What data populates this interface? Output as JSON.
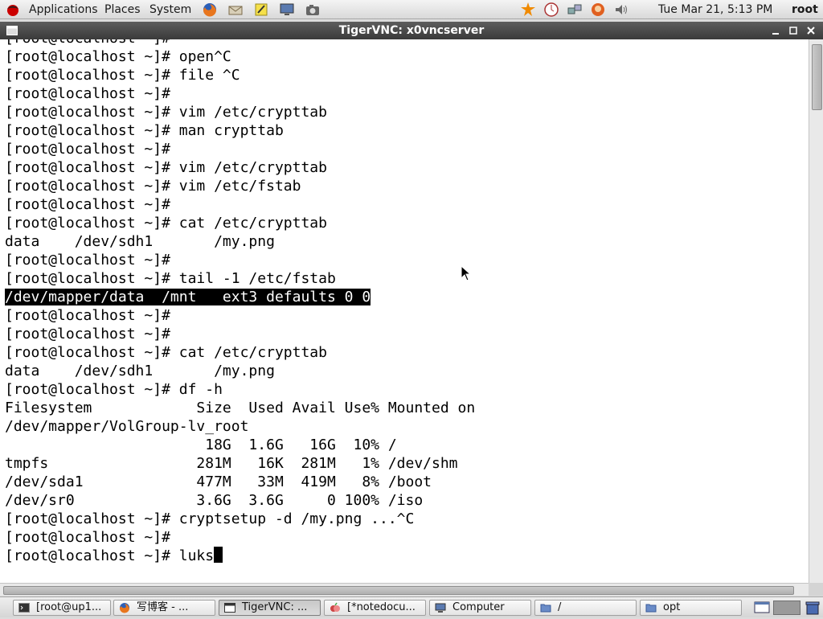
{
  "top_panel": {
    "menus": [
      "Applications",
      "Places",
      "System"
    ],
    "launchers": [
      "firefox-icon",
      "mail-icon",
      "notes-icon",
      "monitor-icon",
      "screenshot-camera-icon"
    ],
    "tray_icons": [
      "update-notifier-icon",
      "time-tracker-icon",
      "network-icon",
      "user-switch-icon",
      "volume-icon"
    ],
    "clock": "Tue Mar 21,  5:13 PM",
    "user": "root"
  },
  "window": {
    "title": "TigerVNC: x0vncserver",
    "buttons": [
      "minimize",
      "maximize",
      "close"
    ]
  },
  "terminal": {
    "lines": [
      "[root@localhost ~]#",
      "[root@localhost ~]# open^C",
      "[root@localhost ~]# file ^C",
      "[root@localhost ~]#",
      "[root@localhost ~]# vim /etc/crypttab",
      "[root@localhost ~]# man crypttab",
      "[root@localhost ~]#",
      "[root@localhost ~]# vim /etc/crypttab",
      "[root@localhost ~]# vim /etc/fstab",
      "[root@localhost ~]#",
      "[root@localhost ~]# cat /etc/crypttab",
      "data    /dev/sdh1       /my.png",
      "[root@localhost ~]#",
      "[root@localhost ~]# tail -1 /etc/fstab",
      "/dev/mapper/data  /mnt   ext3 defaults 0 0",
      "[root@localhost ~]#",
      "[root@localhost ~]#",
      "[root@localhost ~]# cat /etc/crypttab",
      "data    /dev/sdh1       /my.png",
      "[root@localhost ~]# df -h",
      "Filesystem            Size  Used Avail Use% Mounted on",
      "/dev/mapper/VolGroup-lv_root",
      "                       18G  1.6G   16G  10% /",
      "tmpfs                 281M   16K  281M   1% /dev/shm",
      "/dev/sda1             477M   33M  419M   8% /boot",
      "/dev/sr0              3.6G  3.6G     0 100% /iso",
      "[root@localhost ~]# cryptsetup -d /my.png ...^C",
      "[root@localhost ~]#",
      "[root@localhost ~]# luks"
    ],
    "selected_line_index": 14
  },
  "taskbar": {
    "items": [
      {
        "label": "[root@up1...",
        "icon": "terminal-icon",
        "active": false
      },
      {
        "label": "写博客 - ...",
        "icon": "firefox-icon",
        "active": false
      },
      {
        "label": "TigerVNC: ...",
        "icon": "vnc-window-icon",
        "active": true
      },
      {
        "label": "[*notedocu...",
        "icon": "notes-app-icon",
        "active": false
      },
      {
        "label": "Computer",
        "icon": "computer-icon",
        "active": false
      },
      {
        "label": "/",
        "icon": "folder-icon",
        "active": false
      },
      {
        "label": "opt",
        "icon": "folder-icon",
        "active": false
      }
    ]
  },
  "colors": {
    "titlebar": "#3a3a3a",
    "terminal_bg": "#ffffff",
    "terminal_fg": "#000000",
    "selection_bg": "#000000"
  }
}
